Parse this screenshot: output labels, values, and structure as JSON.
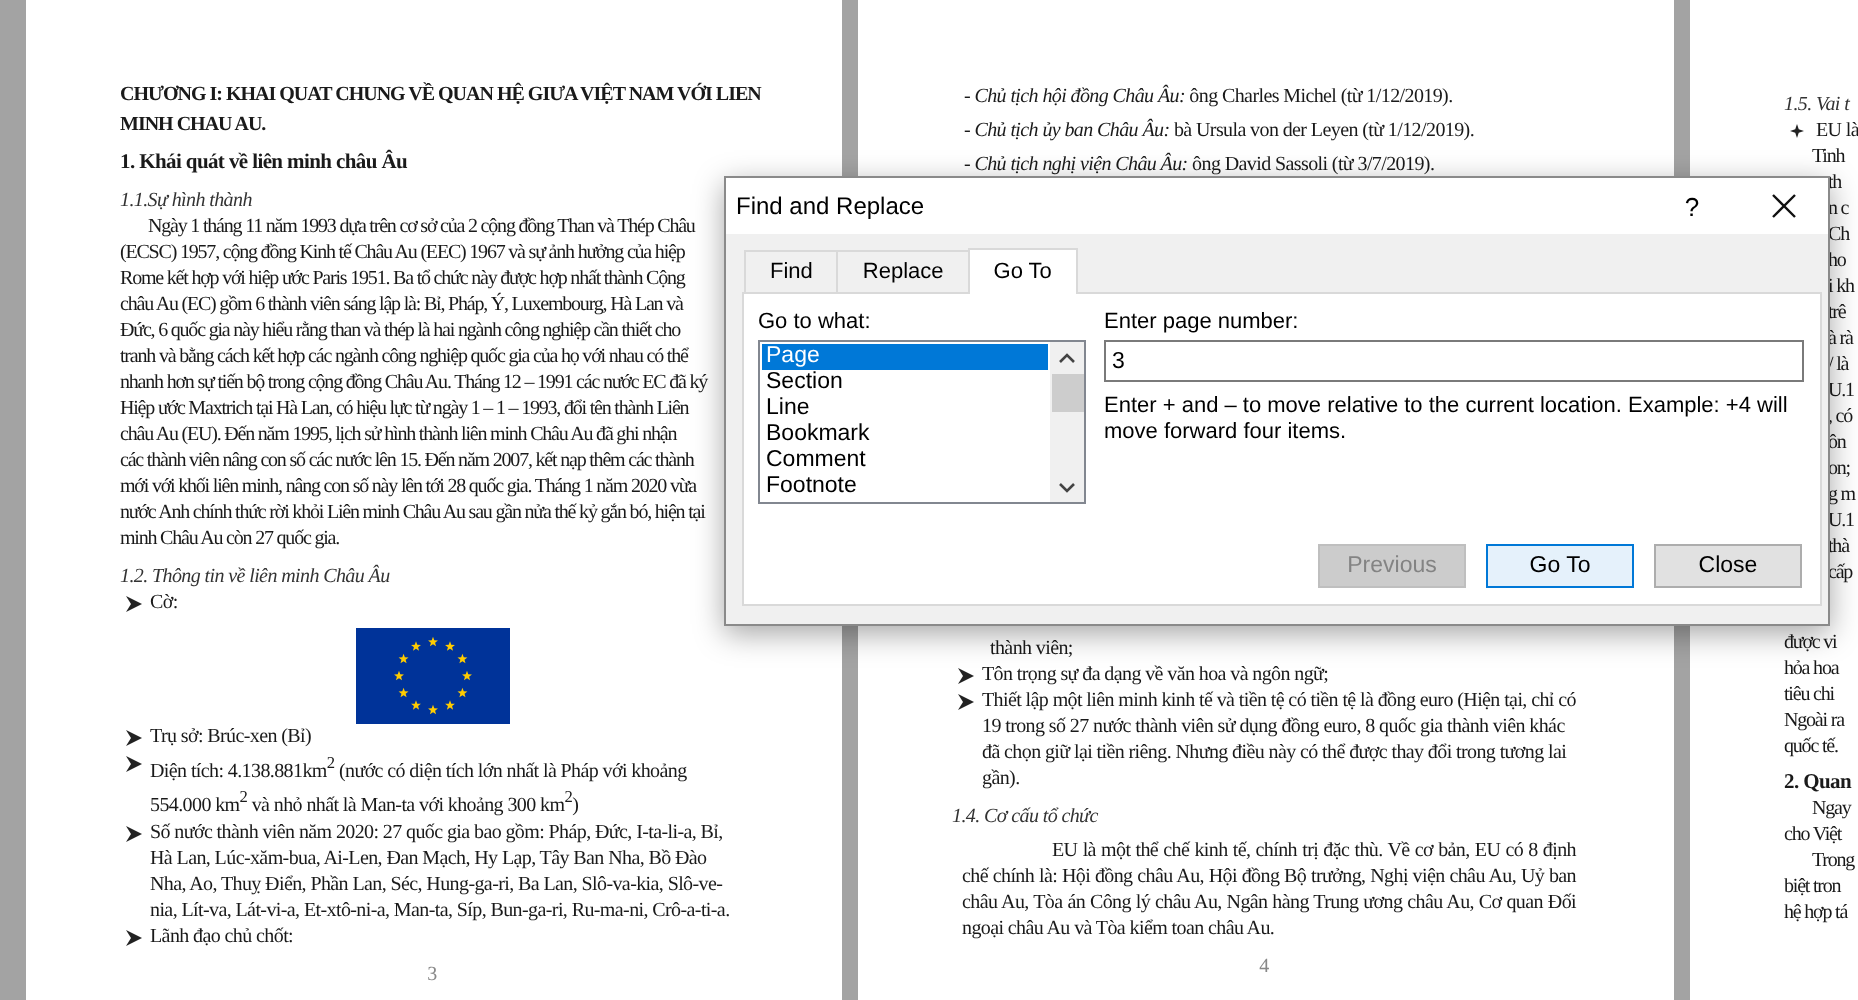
{
  "pages": [
    {
      "number": "3",
      "top": [
        {
          "kind": "heading",
          "text": "CHƯƠNG I: KHAI QUAT CHUNG VỀ QUAN HỆ GIƯA VIỆT NAM VỚI LIEN MINH CHAU AU."
        },
        {
          "kind": "section",
          "text": "1.  Khái quát về liên minh châu Âu"
        },
        {
          "kind": "subheading",
          "text": "1.1.Sự hình thành"
        },
        {
          "kind": "paragraph-lines",
          "lines": [
            "Ngày 1 tháng 11 năm 1993 dựa trên cơ sở của 2 cộng đồng Than và Thép Châu",
            "(ECSC) 1957, cộng đồng Kinh tế Châu Au (EEC) 1967 và sự ảnh hưởng của hiệp",
            "Rome kết hợp với hiệp ước Paris 1951. Ba tổ chức này được hợp nhất thành Cộng",
            "châu Au (EC) gồm 6 thành viên sáng lập là: Bỉ, Pháp, Ý, Luxembourg, Hà Lan và",
            "Đức, 6 quốc gia này hiểu rằng than và thép là hai ngành công nghiệp cần thiết cho",
            "tranh và bằng cách kết hợp các ngành công nghiệp quốc gia của họ với nhau có thể",
            "nhanh hơn sự tiến bộ trong cộng đồng Châu Au. Tháng 12 – 1991 các nước EC đã ký",
            "Hiệp ước Maxtrich tại Hà Lan, có hiệu lực từ ngày 1 – 1 – 1993, đổi tên thành Liên",
            "châu Au (EU). Đến năm 1995, lịch sử hình thành liên minh Châu Au đã ghi nhận",
            "các thành viên nâng con số các nước lên 15. Đến năm 2007, kết nạp thêm các thành",
            "mới với khối liên minh, nâng con số này lên tới 28 quốc gia. Tháng 1 năm 2020 vừa",
            "nước Anh chính thức rời khỏi Liên minh Châu Au sau gần nửa thế kỷ gắn bó, hiện tại",
            "minh Châu Au còn 27 quốc gia."
          ]
        },
        {
          "kind": "subheading",
          "text": "1.2. Thông tin về liên minh Châu Âu"
        },
        {
          "kind": "bullet",
          "text": "Cờ:"
        },
        {
          "kind": "flag"
        },
        {
          "kind": "bullet",
          "text": "Trụ sở: Brúc-xen (Bỉ)"
        },
        {
          "kind": "bullet",
          "text": "Diện tích: 4.138.881km$^{2}$ (nước có diện tích lớn nhất là Pháp với khoảng 554.000 km$^{2}$ và nhỏ nhất là Man-ta với khoảng 300 km$^{2}$)"
        },
        {
          "kind": "bullet",
          "text": "Số nước thành viên năm 2020: 27 quốc gia bao gồm: Pháp, Đức, I-ta-li-a, Bỉ, Hà Lan, Lúc-xăm-bua, Ai-Len, Đan Mạch, Hy Lạp, Tây Ban Nha, Bồ Đào Nha, Ao, Thuỵ Điển, Phần Lan, Séc, Hung-ga-ri, Ba Lan, Slô-va-kia, Slô-ve-nia, Lít-va, Lát-vi-a, Et-xtô-ni-a, Man-ta, Síp, Bun-ga-ri, Ru-ma-ni, Crô-a-ti-a."
        },
        {
          "kind": "bullet",
          "text": "Lãnh đạo chủ chốt:"
        }
      ]
    },
    {
      "number": "4",
      "top": [
        {
          "kind": "dash",
          "text": "*- Chủ tịch hội đồng Châu Âu:* ông Charles Michel (từ 1/12/2019)."
        },
        {
          "kind": "dash",
          "text": "*- Chủ tịch ủy ban Châu Âu:* bà Ursula von der Leyen (từ 1/12/2019)."
        },
        {
          "kind": "dash",
          "text": "*- Chủ tịch nghị viện Châu Âu:* ông David Sassoli (từ 3/7/2019)."
        }
      ],
      "bottom": [
        {
          "kind": "continuation",
          "text": "thành viên;"
        },
        {
          "kind": "bullet",
          "text": "Tôn trọng sự đa dạng về văn hoa và ngôn ngữ;"
        },
        {
          "kind": "bullet",
          "text": "Thiết lập một liên minh kinh tế và tiền tệ có tiền tệ là đồng euro (Hiện tại, chỉ có 19 trong số 27 nước thành viên sử dụng đồng euro, 8 quốc gia thành viên khác đã chọn giữ lại tiền riêng. Nhưng điều này có thể được thay đổi trong tương lai gần)."
        },
        {
          "kind": "subheading",
          "text": "1.4. Cơ cấu tổ chức"
        },
        {
          "kind": "paragraph",
          "text": "EU là một thể chế kinh tế, chính trị đặc thù. Về cơ bản, EU có 8 định chế chính là: Hội đồng châu Au, Hội đồng Bộ trưởng, Nghị viện châu Au, Uỷ ban châu Au, Tòa án Công lý châu Au, Ngân hàng Trung ương châu Au, Cơ quan Đối ngoại châu Au và Tòa kiểm toan châu Au."
        }
      ]
    },
    {
      "top": [
        {
          "kind": "subheading",
          "text": "1.5. Vai t"
        },
        {
          "kind": "star-bullet",
          "text": "EU là"
        },
        {
          "kind": "paragraph-lines",
          "lines": [
            "Tinh"
          ]
        },
        {
          "kind": "fragments",
          "lines": [
            "th",
            "n c",
            "Ch",
            "ho",
            "i kh",
            "trê",
            "à rà",
            "/ là",
            "U.1",
            ", có",
            "ôn",
            "on;",
            "g m",
            "U.1",
            "thà",
            "cấp"
          ]
        },
        {
          "kind": "lines",
          "lines": [
            "được vi",
            "hỏa hoa",
            "tiêu chi",
            "Ngoài ra",
            "quốc tế."
          ]
        },
        {
          "kind": "section",
          "text": "2.  Quan"
        },
        {
          "kind": "paragraph-lines",
          "lines": [
            "Ngay",
            "cho Việt"
          ]
        },
        {
          "kind": "paragraph-lines",
          "lines": [
            "Trong",
            "biệt tron",
            "hệ hợp tá"
          ]
        }
      ]
    }
  ],
  "dialog": {
    "title": "Find and Replace",
    "help": "?",
    "tabs": [
      {
        "label": "Find",
        "selected": false
      },
      {
        "label": "Replace",
        "selected": false
      },
      {
        "label": "Go To",
        "selected": true
      }
    ],
    "goto_label": "Go to what:",
    "targets": [
      {
        "label": "Page",
        "selected": true
      },
      {
        "label": "Section",
        "selected": false
      },
      {
        "label": "Line",
        "selected": false
      },
      {
        "label": "Bookmark",
        "selected": false
      },
      {
        "label": "Comment",
        "selected": false
      },
      {
        "label": "Footnote",
        "selected": false
      }
    ],
    "input_label": "Enter page number:",
    "input_value": "3",
    "hint": "Enter + and – to move relative to the current location. Example: +4 will move forward four items.",
    "buttons": [
      {
        "label": "Previous",
        "disabled": true,
        "default": false
      },
      {
        "label": "Go To",
        "disabled": false,
        "default": true
      },
      {
        "label": "Close",
        "disabled": false,
        "default": false
      }
    ]
  }
}
